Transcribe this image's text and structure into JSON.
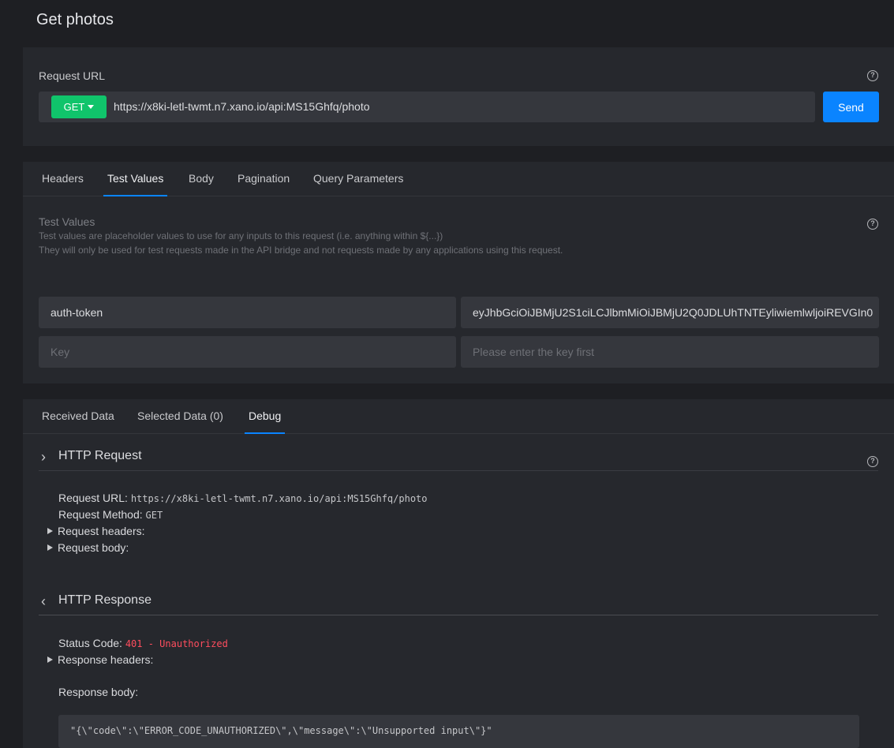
{
  "page": {
    "title": "Get photos"
  },
  "request": {
    "label": "Request URL",
    "method": "GET",
    "url": "https://x8ki-letl-twmt.n7.xano.io/api:MS15Ghfq/photo",
    "send_label": "Send"
  },
  "config_tabs": [
    {
      "label": "Headers",
      "active": false
    },
    {
      "label": "Test Values",
      "active": true
    },
    {
      "label": "Body",
      "active": false
    },
    {
      "label": "Pagination",
      "active": false
    },
    {
      "label": "Query Parameters",
      "active": false
    }
  ],
  "test_values": {
    "title": "Test Values",
    "desc1": "Test values are placeholder values to use for any inputs to this request (i.e. anything within ${...})",
    "desc2": "They will only be used for test requests made in the API bridge and not requests made by any applications using this request.",
    "rows": [
      {
        "key": "auth-token",
        "value": "eyJhbGciOiJBMjU2S1ciLCJlbmMiOiJBMjU2Q0JDLUhTNTEyliwiemlwljoiREVGIn0"
      }
    ],
    "key_placeholder": "Key",
    "value_placeholder": "Please enter the key first"
  },
  "result_tabs": [
    {
      "label": "Received Data",
      "active": false
    },
    {
      "label": "Selected Data (0)",
      "active": false
    },
    {
      "label": "Debug",
      "active": true
    }
  ],
  "debug": {
    "request": {
      "title": "HTTP Request",
      "url_label": "Request URL:",
      "url_value": "https://x8ki-letl-twmt.n7.xano.io/api:MS15Ghfq/photo",
      "method_label": "Request Method:",
      "method_value": "GET",
      "headers_label": "Request headers:",
      "body_label": "Request body:"
    },
    "response": {
      "title": "HTTP Response",
      "status_label": "Status Code:",
      "status_value": "401 - Unauthorized",
      "headers_label": "Response headers:",
      "body_label": "Response body:",
      "body_value": "\"{\\\"code\\\":\\\"ERROR_CODE_UNAUTHORIZED\\\",\\\"message\\\":\\\"Unsupported input\\\"}\""
    }
  },
  "icons": {
    "help": "?"
  },
  "colors": {
    "accent": "#0a84ff",
    "method": "#10c46b",
    "error": "#ff4d5e"
  }
}
